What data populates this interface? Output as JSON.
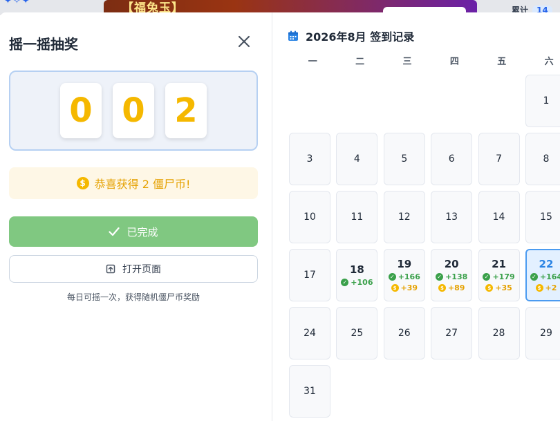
{
  "background": {
    "banner_title": "【福兔玉】",
    "right_label": "累计",
    "right_badge": "14"
  },
  "lottery": {
    "title": "摇一摇抽奖",
    "digits": [
      "0",
      "0",
      "2"
    ],
    "congrats_text": "恭喜获得 2 僵尸币!",
    "coin_symbol": "$",
    "done_label": "已完成",
    "open_label": "打开页面",
    "hint": "每日可摇一次，获得随机僵尸币奖励"
  },
  "calendar": {
    "title": "2026年8月 签到记录",
    "weekdays": [
      "一",
      "二",
      "三",
      "四",
      "五",
      "六"
    ],
    "days": [
      {
        "day": "",
        "empty": true
      },
      {
        "day": "",
        "empty": true
      },
      {
        "day": "",
        "empty": true
      },
      {
        "day": "",
        "empty": true
      },
      {
        "day": "",
        "empty": true
      },
      {
        "day": "1"
      },
      {
        "day": "",
        "empty": true
      },
      {
        "day": "3"
      },
      {
        "day": "4"
      },
      {
        "day": "5"
      },
      {
        "day": "6"
      },
      {
        "day": "7"
      },
      {
        "day": "8"
      },
      {
        "day": "",
        "empty": true
      },
      {
        "day": "10"
      },
      {
        "day": "11"
      },
      {
        "day": "12"
      },
      {
        "day": "13"
      },
      {
        "day": "14"
      },
      {
        "day": "15"
      },
      {
        "day": "",
        "empty": true
      },
      {
        "day": "17"
      },
      {
        "day": "18",
        "signed": true,
        "checkin": "+106"
      },
      {
        "day": "19",
        "signed": true,
        "checkin": "+166",
        "bonus": "+39"
      },
      {
        "day": "20",
        "signed": true,
        "checkin": "+138",
        "bonus": "+89"
      },
      {
        "day": "21",
        "signed": true,
        "checkin": "+179",
        "bonus": "+35"
      },
      {
        "day": "22",
        "signed": true,
        "today": true,
        "checkin": "+164",
        "bonus": "+2"
      },
      {
        "day": "",
        "empty": true
      },
      {
        "day": "24"
      },
      {
        "day": "25"
      },
      {
        "day": "26"
      },
      {
        "day": "27"
      },
      {
        "day": "28"
      },
      {
        "day": "29"
      },
      {
        "day": "",
        "empty": true
      },
      {
        "day": "31"
      }
    ]
  },
  "colors": {
    "digit": "#f5b800",
    "done_button": "#80c881",
    "accent_blue": "#2b84e4",
    "reward_green": "#3aa04a",
    "reward_gold": "#e5a100"
  }
}
